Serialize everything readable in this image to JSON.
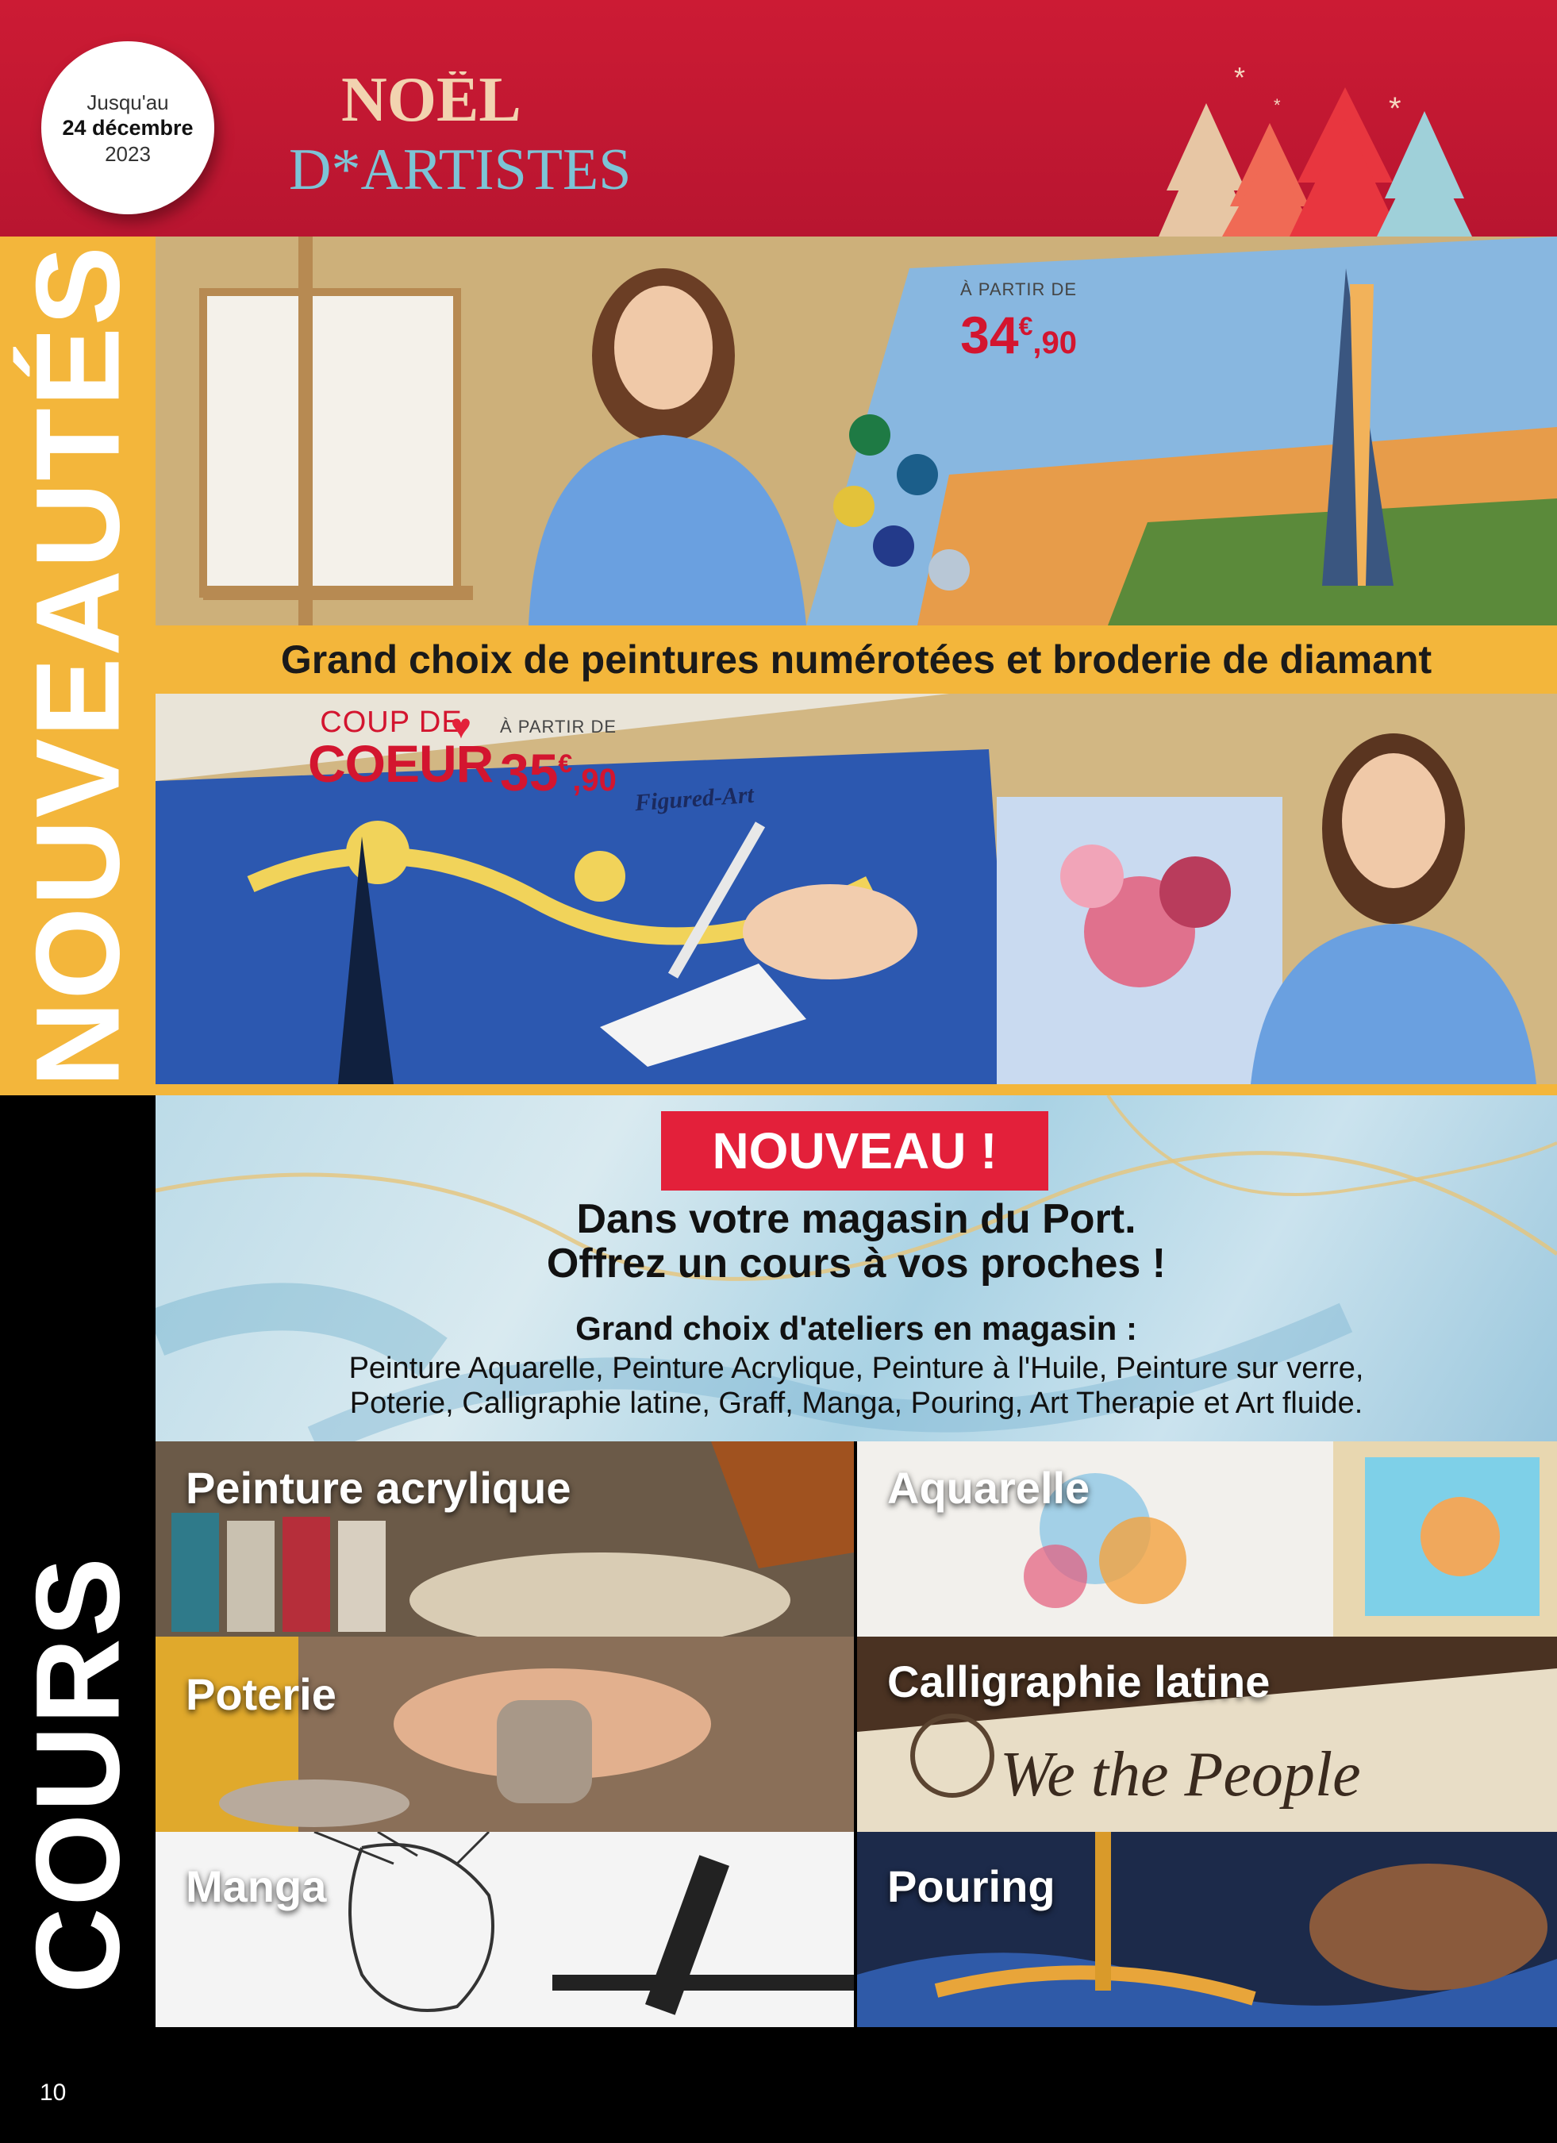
{
  "header": {
    "date_line1": "Jusqu'au",
    "date_line2": "24 décembre",
    "date_line3": "2023",
    "logo_line1": "NOËL",
    "logo_line2": "D*ARTISTES"
  },
  "side_labels": {
    "nouveautes": "NOUVEAUTÉS",
    "cours": "COURS"
  },
  "nouveautes": {
    "price1_from": "À PARTIR DE",
    "price1_int": "34",
    "price1_currency": "€",
    "price1_dec": ",90",
    "caption": "Grand choix de peintures numérotées et broderie de diamant",
    "coup_line1": "COUP DE",
    "coup_line2": "COEUR",
    "heart_icon": "♥",
    "price2_from": "À PARTIR DE",
    "price2_int": "35",
    "price2_currency": "€",
    "price2_dec": ",90",
    "product_box_text": "Figured-Art"
  },
  "cours": {
    "badge": "NOUVEAU !",
    "line1": "Dans votre magasin du Port.",
    "line2": "Offrez un cours à vos proches !",
    "line3": "Grand choix d'ateliers en magasin :",
    "line4": "Peinture Aquarelle, Peinture Acrylique, Peinture à l'Huile, Peinture sur verre,",
    "line5": "Poterie, Calligraphie latine, Graff, Manga, Pouring, Art Therapie et Art fluide.",
    "tiles": [
      {
        "label": "Peinture acrylique"
      },
      {
        "label": "Aquarelle"
      },
      {
        "label": "Poterie"
      },
      {
        "label": "Calligraphie latine"
      },
      {
        "label": "Manga"
      },
      {
        "label": "Pouring"
      }
    ]
  },
  "page_number": "10",
  "colors": {
    "header_red": "#cc1b34",
    "accent_yellow": "#f3b63b",
    "price_red": "#d3152f",
    "badge_red": "#e3203a"
  }
}
